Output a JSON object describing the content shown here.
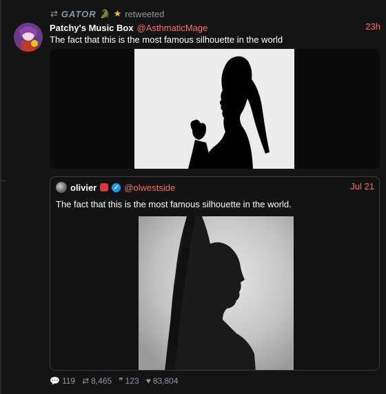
{
  "retweet": {
    "icon": "retweet-icon",
    "name": "GATOR",
    "emoji1": "🐊",
    "emoji2": "★",
    "label": "retweeted"
  },
  "tweet": {
    "author_name": "Patchy's Music Box",
    "handle": "@AsthmaticMage",
    "time": "23h",
    "text": "The fact that this is the most famous silhouette in the world"
  },
  "quote": {
    "author_name": "olivier",
    "handle": "@olwestside",
    "time": "Jul 21",
    "text": "The fact that this is the most famous silhouette in the world."
  },
  "actions": {
    "replies": "119",
    "retweets": "8,465",
    "quotes": "123",
    "likes": "83,804"
  },
  "colors": {
    "accent": "#f0726a",
    "verified": "#1d9bf0",
    "background": "#141414"
  }
}
